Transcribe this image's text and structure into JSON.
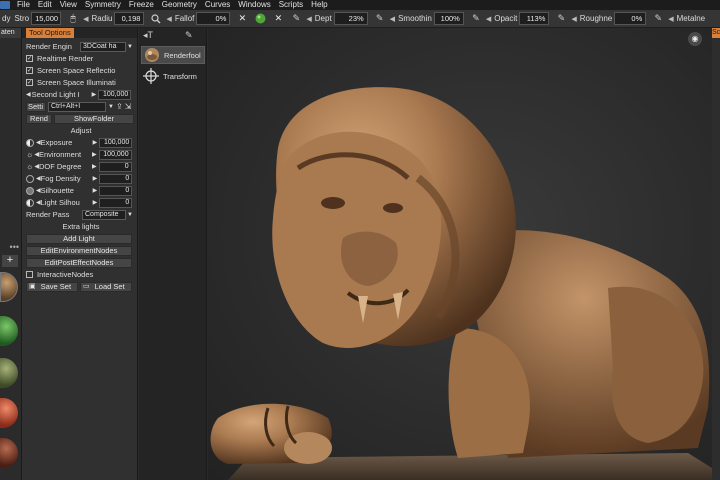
{
  "menu": {
    "items": [
      "File",
      "Edit",
      "View",
      "Symmetry",
      "Freeze",
      "Geometry",
      "Curves",
      "Windows",
      "Scripts",
      "Help"
    ]
  },
  "toolbar": {
    "ready_label": "dy",
    "stroke_label": "Stro",
    "stroke_value": "15,000",
    "radius_label": "Radiu",
    "radius_value": "0,198",
    "falloff_label": "Fallof",
    "falloff_value": "0%",
    "depth_label": "Dept",
    "depth_value": "23%",
    "smoothing_label": "Smoothin",
    "smoothing_value": "100%",
    "opacity_label": "Opacit",
    "opacity_value": "113%",
    "roughness_label": "Roughne",
    "roughness_value": "0%",
    "metalness_label": "Metalne"
  },
  "left_panel": {
    "tab_label": "aten",
    "more_dots": "•••",
    "add_button": "+"
  },
  "tool_options": {
    "tab_label": "Tool Options",
    "render_engine_label": "Render Engin",
    "render_engine_value": "3DCoat ha",
    "realtime_render": "Realtime Render",
    "ssr": "Screen Space Reflectio",
    "ssi": "Screen Space Illuminati",
    "second_light_label": "Second Light I",
    "second_light_value": "100,000",
    "settings_label": "Setti",
    "settings_value": "Ctrl+Alt+I",
    "render_button": "Rend",
    "show_folder_button": "ShowFolder",
    "adjust_label": "Adjust",
    "exposure_label": "Exposure",
    "exposure_value": "100,000",
    "environment_label": "Environment",
    "environment_value": "100,000",
    "dof_label": "DOF Degree",
    "dof_value": "0",
    "fog_label": "Fog Density",
    "fog_value": "0",
    "silhouette_label": "Silhouette",
    "silhouette_value": "0",
    "light_silhouette_label": "Light Silhou",
    "light_silhouette_value": "0",
    "render_pass_label": "Render Pass",
    "render_pass_value": "Composite",
    "extra_lights_label": "Extra lights",
    "add_light_button": "Add Light",
    "edit_env_nodes_button": "EditEnvironmentNodes",
    "edit_post_nodes_button": "EditPostEffectNodes",
    "interactive_nodes": "InteractiveNodes",
    "save_settings_button": "Save Set",
    "load_settings_button": "Load Set"
  },
  "tool_list": {
    "items": [
      {
        "label": "Renderfool",
        "icon": "render-ball-icon",
        "active": true
      },
      {
        "label": "Transform",
        "icon": "transform-icon",
        "active": false
      }
    ]
  },
  "right_strip": {
    "tab_label": "Sc"
  },
  "colors": {
    "accent": "#d8803a",
    "panel_bg": "#303030",
    "viewport_bg": "#2b2b2b",
    "model_clay": "#a8784f"
  }
}
